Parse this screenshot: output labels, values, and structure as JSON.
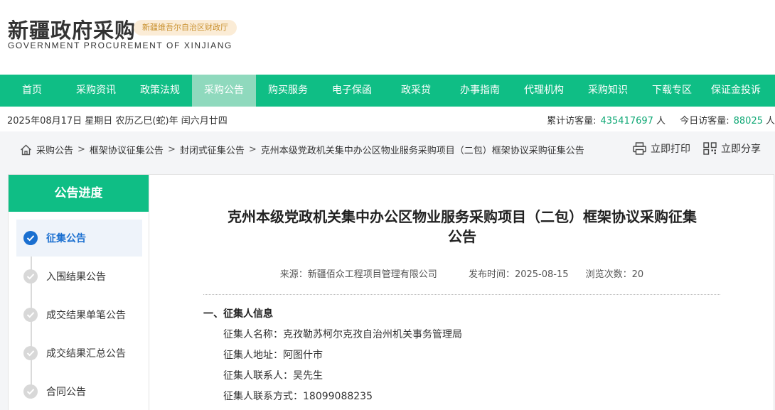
{
  "header": {
    "logo_cn": "新疆政府采购",
    "badge": "新疆维吾尔自治区财政厅",
    "logo_en": "GOVERNMENT PROCUREMENT OF XINJIANG"
  },
  "nav": {
    "items": [
      {
        "label": "首页"
      },
      {
        "label": "采购资讯"
      },
      {
        "label": "政策法规"
      },
      {
        "label": "采购公告"
      },
      {
        "label": "购买服务"
      },
      {
        "label": "电子保函"
      },
      {
        "label": "政采贷"
      },
      {
        "label": "办事指南"
      },
      {
        "label": "代理机构"
      },
      {
        "label": "采购知识"
      },
      {
        "label": "下载专区"
      },
      {
        "label": "保证金投诉"
      }
    ],
    "active_index": 3
  },
  "infobar": {
    "date": "2025年08月17日 星期日 农历乙巳(蛇)年 闰六月廿四",
    "total_label": "累计访客量:",
    "total_value": "435417697",
    "total_unit": "人",
    "today_label": "今日访客量:",
    "today_value": "88025",
    "today_unit": "人"
  },
  "breadcrumb": {
    "items": [
      "采购公告",
      "框架协议征集公告",
      "封闭式征集公告",
      "克州本级党政机关集中办公区物业服务采购项目（二包）框架协议采购征集公告"
    ],
    "sep": ">"
  },
  "actions": {
    "print": "立即打印",
    "share": "立即分享"
  },
  "sidebar": {
    "title": "公告进度",
    "steps": [
      {
        "label": "征集公告"
      },
      {
        "label": "入围结果公告"
      },
      {
        "label": "成交结果单笔公告"
      },
      {
        "label": "成交结果汇总公告"
      },
      {
        "label": "合同公告"
      }
    ]
  },
  "article": {
    "title_line1": "克州本级党政机关集中办公区物业服务采购项目（二包）框架协议采购征集",
    "title_line2": "公告",
    "source": "来源：新疆佰众工程项目管理有限公司",
    "publish": "发布时间：2025-08-15",
    "views": "浏览次数：20",
    "section1": "一、征集人信息",
    "rows": [
      "征集人名称：克孜勒苏柯尔克孜自治州机关事务管理局",
      "征集人地址：阿图什市",
      "征集人联系人：吴先生",
      "征集人联系方式：18099088235"
    ]
  },
  "colors": {
    "brand": "#0fbe85",
    "active_nav": "#8fd9bd",
    "step_active": "#1a6fd0"
  }
}
